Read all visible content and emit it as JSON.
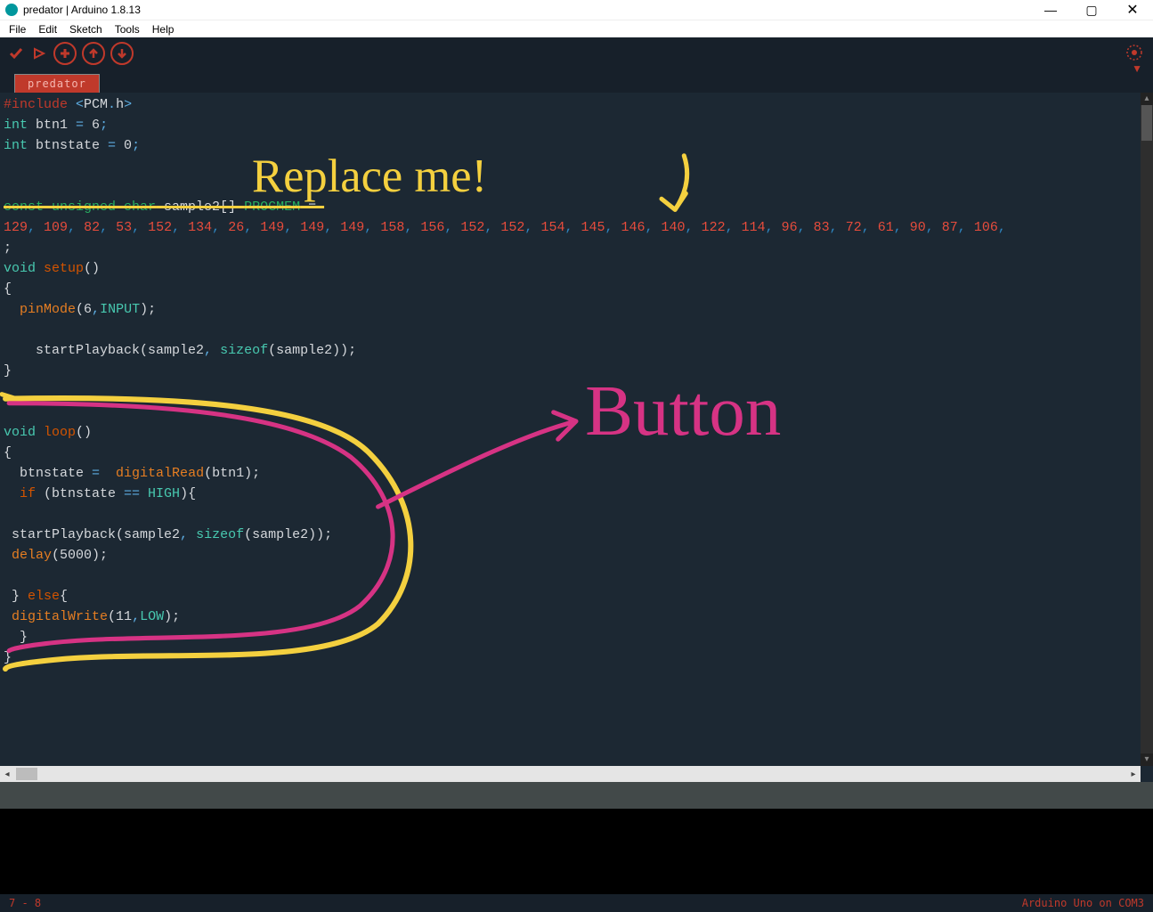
{
  "title": "predator | Arduino 1.8.13",
  "menus": [
    "File",
    "Edit",
    "Sketch",
    "Tools",
    "Help"
  ],
  "tab": "predator",
  "status_left": "7 - 8",
  "status_right": "Arduino Uno on COM3",
  "annotations": {
    "replace": "Replace me!",
    "button": "Button"
  },
  "code": {
    "l1_inc": "#include ",
    "l1_lt": "<",
    "l1_h": "PCM",
    "l1_dot": ".",
    "l1_h2": "h",
    "l1_gt": ">",
    "l2a": "int",
    "l2b": " btn1 ",
    "l2c": "=",
    "l2d": " 6",
    "l2e": ";",
    "l3a": "int",
    "l3b": " btnstate ",
    "l3c": "=",
    "l3d": " 0",
    "l3e": ";",
    "sel_decl_a": "const unsigned char",
    "sel_decl_b": " sample2[] ",
    "sel_decl_c": "PROGMEM",
    "sel_decl_d": " = ",
    "sel_nums": [
      129,
      109,
      82,
      53,
      152,
      134,
      26,
      149,
      149,
      149,
      158,
      156,
      152,
      152,
      154,
      145,
      146,
      140,
      122,
      114,
      96,
      83,
      72,
      61,
      90,
      87,
      106
    ],
    "sel_tail": ";",
    "s1a": "void",
    "s1b": " setup",
    "s1c": "()",
    "s2": "{",
    "s3a": "  pinMode",
    "s3b": "(",
    "s3c": "6",
    "s3d": ",",
    "s3e": "INPUT",
    "s3f": ");",
    "s5a": "    startPlayback(sample2",
    "s5b": ",",
    "s5c": " sizeof",
    "s5d": "(sample2));",
    "s6": "}",
    "l1v": "void",
    "l1l": " loop",
    "l1p": "()",
    "l2": "{",
    "l3": "  btnstate ",
    "l3eq": "=",
    "l3r": "  digitalRead",
    "l3p": "(btn1);",
    "l4a": "  if ",
    "l4b": "(btnstate ",
    "l4c": "==",
    "l4d": " HIGH",
    "l4e": "){",
    "l6a": " startPlayback(sample2",
    "l6b": ",",
    "l6c": " sizeof",
    "l6d": "(sample2));",
    "l7a": " delay",
    "l7b": "(",
    "l7c": "5000",
    "l7d": ");",
    "l9a": " } ",
    "l9b": "else",
    "l9c": "{",
    "l10a": " digitalWrite",
    "l10b": "(",
    "l10c": "11",
    "l10d": ",",
    "l10e": "LOW",
    "l10f": ");",
    "l11": "  }",
    "l12": "}"
  }
}
